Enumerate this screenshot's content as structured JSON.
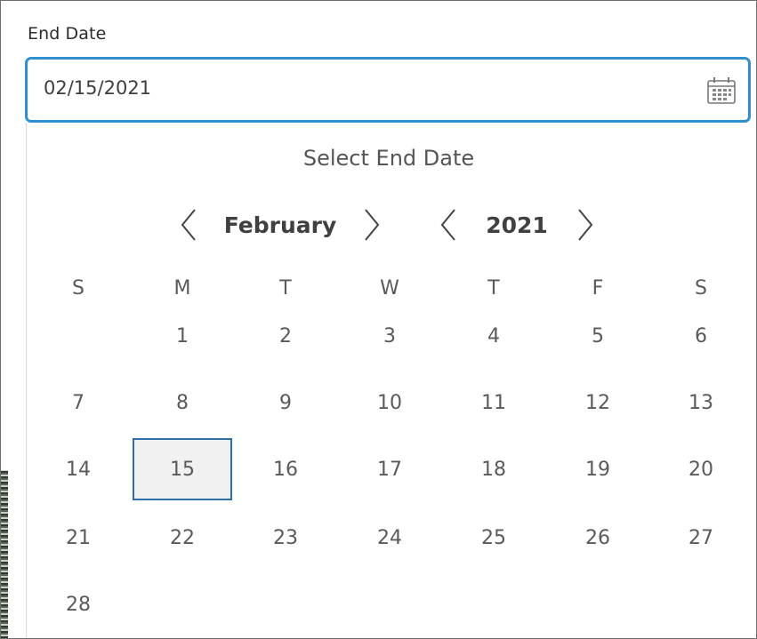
{
  "field": {
    "label": "End Date",
    "value": "02/15/2021",
    "calendar_icon": "calendar-icon"
  },
  "picker": {
    "title": "Select End Date",
    "month": "February",
    "year": "2021",
    "weekdays": [
      "S",
      "M",
      "T",
      "W",
      "T",
      "F",
      "S"
    ],
    "weeks": [
      [
        "",
        "1",
        "2",
        "3",
        "4",
        "5",
        "6"
      ],
      [
        "7",
        "8",
        "9",
        "10",
        "11",
        "12",
        "13"
      ],
      [
        "14",
        "15",
        "16",
        "17",
        "18",
        "19",
        "20"
      ],
      [
        "21",
        "22",
        "23",
        "24",
        "25",
        "26",
        "27"
      ],
      [
        "28",
        "",
        "",
        "",
        "",
        "",
        ""
      ]
    ],
    "selected_day": "15"
  },
  "colors": {
    "focus_border": "#2f8fd0",
    "selected_border": "#2a6fab",
    "selected_fill": "#f1f1f1"
  }
}
